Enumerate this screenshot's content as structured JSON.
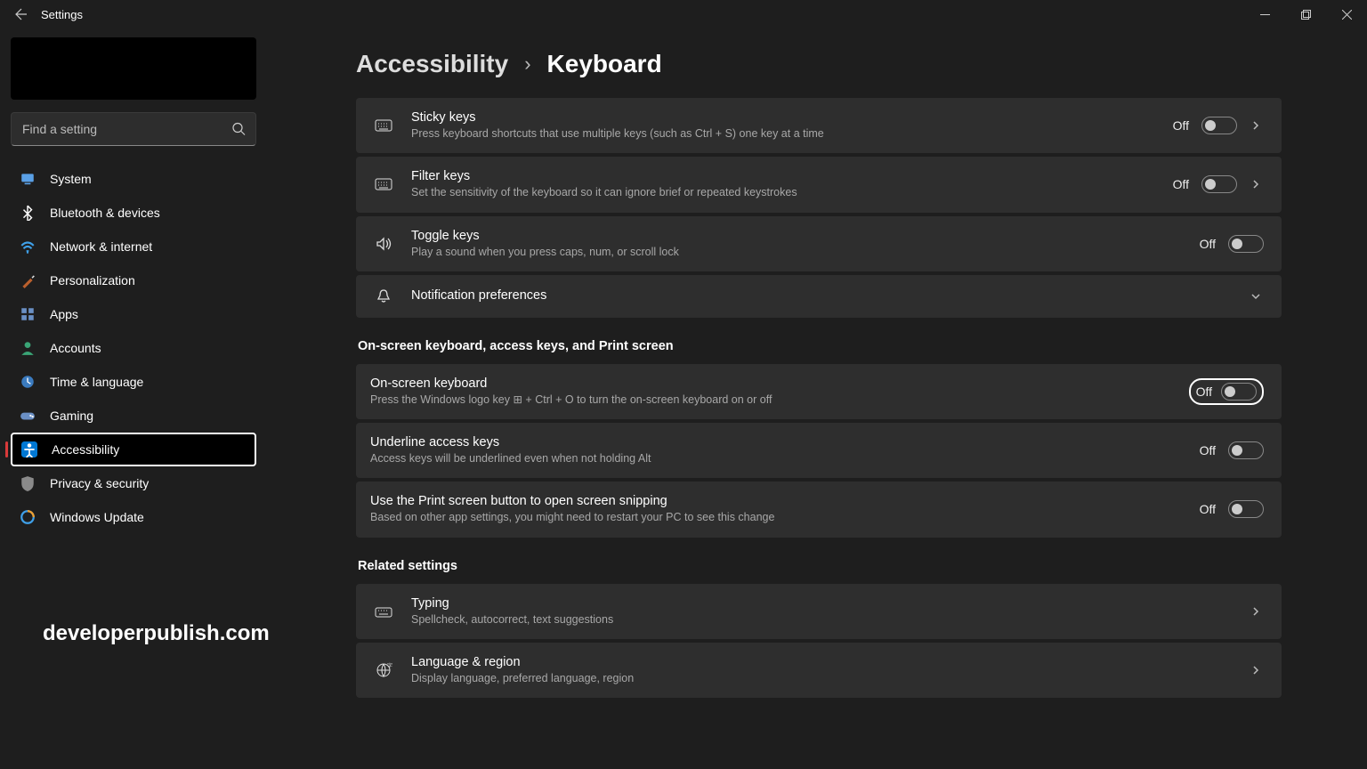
{
  "window": {
    "title": "Settings"
  },
  "sidebar": {
    "search_placeholder": "Find a setting",
    "items": [
      {
        "label": "System",
        "icon": "monitor",
        "bg": "#0078d4"
      },
      {
        "label": "Bluetooth & devices",
        "icon": "bluetooth",
        "bg": "#0078d4"
      },
      {
        "label": "Network & internet",
        "icon": "wifi",
        "bg": "#0078d4"
      },
      {
        "label": "Personalization",
        "icon": "brush",
        "bg": "#b95f2d"
      },
      {
        "label": "Apps",
        "icon": "grid",
        "bg": "#4a6fa5"
      },
      {
        "label": "Accounts",
        "icon": "person",
        "bg": "#2c8a5f"
      },
      {
        "label": "Time & language",
        "icon": "clock",
        "bg": "#3b7bbf"
      },
      {
        "label": "Gaming",
        "icon": "gamepad",
        "bg": "#4a6fa5"
      },
      {
        "label": "Accessibility",
        "icon": "person-arms",
        "bg": "#0078d4",
        "selected": true
      },
      {
        "label": "Privacy & security",
        "icon": "shield",
        "bg": "#707070"
      },
      {
        "label": "Windows Update",
        "icon": "update",
        "bg": "#0078d4"
      }
    ]
  },
  "breadcrumb": {
    "parent": "Accessibility",
    "current": "Keyboard"
  },
  "settings": [
    {
      "title": "Sticky keys",
      "desc": "Press keyboard shortcuts that use multiple keys (such as Ctrl + S) one key at a time",
      "state": "Off",
      "chevron": true,
      "icon": "keyboard"
    },
    {
      "title": "Filter keys",
      "desc": "Set the sensitivity of the keyboard so it can ignore brief or repeated keystrokes",
      "state": "Off",
      "chevron": true,
      "icon": "keyboard"
    },
    {
      "title": "Toggle keys",
      "desc": "Play a sound when you press caps, num, or scroll lock",
      "state": "Off",
      "chevron": false,
      "icon": "speaker"
    },
    {
      "title": "Notification preferences",
      "desc": "",
      "expandable": true,
      "icon": "bell"
    }
  ],
  "section2": {
    "heading": "On-screen keyboard, access keys, and Print screen",
    "items": [
      {
        "title": "On-screen keyboard",
        "desc": "Press the Windows logo key ⊞ + Ctrl + O to turn the on-screen keyboard on or off",
        "state": "Off",
        "focused": true
      },
      {
        "title": "Underline access keys",
        "desc": "Access keys will be underlined even when not holding Alt",
        "state": "Off"
      },
      {
        "title": "Use the Print screen button to open screen snipping",
        "desc": "Based on other app settings, you might need to restart your PC to see this change",
        "state": "Off"
      }
    ]
  },
  "related": {
    "heading": "Related settings",
    "items": [
      {
        "title": "Typing",
        "desc": "Spellcheck, autocorrect, text suggestions",
        "icon": "keyboard-typing"
      },
      {
        "title": "Language & region",
        "desc": "Display language, preferred language, region",
        "icon": "globe-lang"
      }
    ]
  },
  "watermark": "developerpublish.com"
}
